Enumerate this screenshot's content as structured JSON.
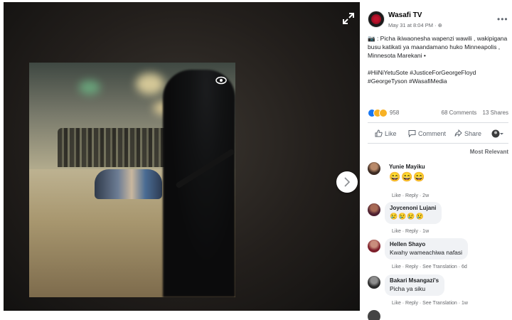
{
  "post": {
    "page_name": "Wasafi TV",
    "time": "May 31 at 8:04 PM · ⊕",
    "caption_line1": "📷 : Picha ikiwaonesha wapenzi wawili , wakipigana busu katikati ya maandamano huko Minneapolis , Minnesota Marekani •",
    "caption_line2": "#HiiNiYetuSote #JusticeForGeorgeFloyd #GeorgeTyson #WasafiMedia",
    "reaction_count": "958",
    "comments_count": "68 Comments",
    "shares_count": "13 Shares"
  },
  "actions": {
    "like": "Like",
    "comment": "Comment",
    "share": "Share"
  },
  "sort_label": "Most Relevant",
  "comments": [
    {
      "name": "Yunie Mayiku",
      "text": "😄😄😄",
      "meta": "Like · Reply · 2w"
    },
    {
      "name": "Joycenoni Lujani",
      "text": "😢😢😢😢",
      "meta": "Like · Reply · 1w"
    },
    {
      "name": "Hellen Shayo",
      "text": "Kwahy wameachiwa nafasi",
      "meta": "Like · Reply · See Translation · 6d"
    },
    {
      "name": "Bakari Msangazi's",
      "text": "Picha ya siku",
      "meta": "Like · Reply · See Translation · 1w"
    }
  ],
  "colors": {
    "link_blue": "#1877f2",
    "meta_gray": "#65676b",
    "bubble_bg": "#f0f2f5"
  }
}
